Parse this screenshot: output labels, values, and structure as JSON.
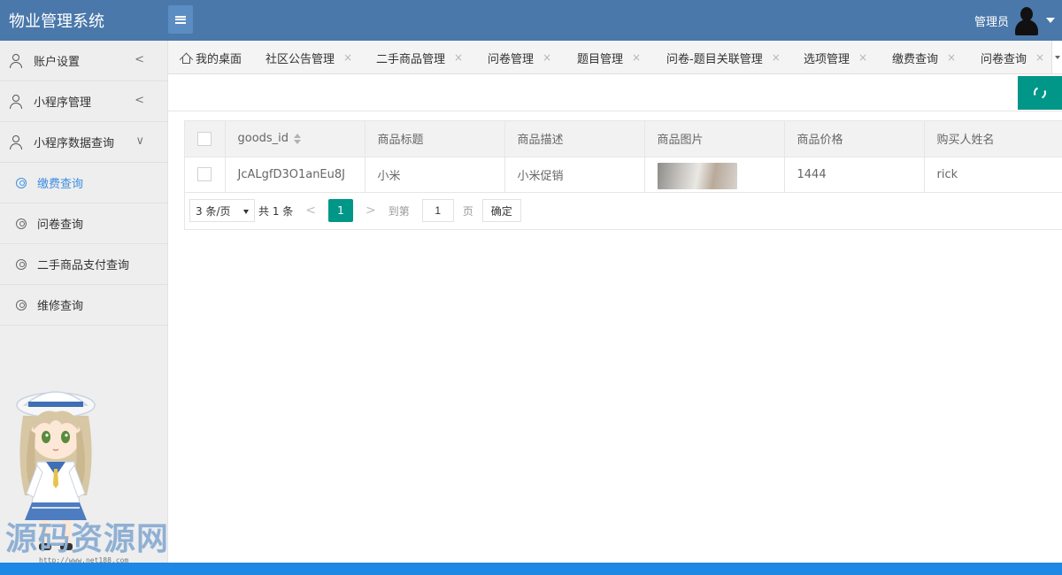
{
  "app": {
    "title": "物业管理系统"
  },
  "header": {
    "user_name": "管理员"
  },
  "sidebar": {
    "items": [
      {
        "label": "账户设置",
        "chevron": "<"
      },
      {
        "label": "小程序管理",
        "chevron": "<"
      },
      {
        "label": "小程序数据查询",
        "chevron": "∨"
      }
    ],
    "sub_items": [
      {
        "label": "缴费查询",
        "active": true
      },
      {
        "label": "问卷查询"
      },
      {
        "label": "二手商品支付查询"
      },
      {
        "label": "维修查询"
      }
    ]
  },
  "watermark": {
    "text": "源码资源网",
    "url": "http://www.net188.com"
  },
  "tabs": [
    {
      "label": "我的桌面"
    },
    {
      "label": "社区公告管理",
      "close": "×"
    },
    {
      "label": "二手商品管理",
      "close": "×"
    },
    {
      "label": "问卷管理",
      "close": "×"
    },
    {
      "label": "题目管理",
      "close": "×"
    },
    {
      "label": "问卷-题目关联管理",
      "close": "×"
    },
    {
      "label": "选项管理",
      "close": "×"
    },
    {
      "label": "缴费查询",
      "close": "×"
    },
    {
      "label": "问卷查询",
      "close": "×"
    }
  ],
  "table": {
    "columns": [
      "goods_id",
      "商品标题",
      "商品描述",
      "商品图片",
      "商品价格",
      "购买人姓名"
    ],
    "rows": [
      {
        "goods_id": "JcALgfD3O1anEu8J",
        "title": "小米",
        "desc": "小米促销",
        "price": "1444",
        "buyer": "rick"
      }
    ]
  },
  "pagination": {
    "limit": "3 条/页",
    "total": "共 1 条",
    "prev": "<",
    "current": "1",
    "next": ">",
    "jump_label": "到第",
    "jump_value": "1",
    "page_label": "页",
    "confirm": "确定"
  },
  "colors": {
    "header": "#4a78aa",
    "accent": "#009688",
    "active_link": "#3d8ee0",
    "bottom_bar": "#1e88e5"
  }
}
